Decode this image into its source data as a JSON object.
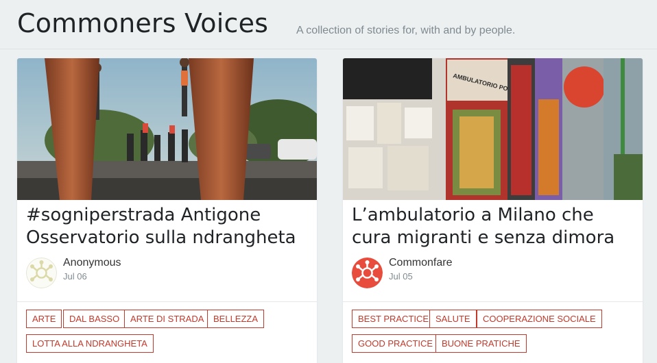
{
  "header": {
    "title": "Commoners Voices",
    "tagline": "A collection of stories for, with and by people."
  },
  "cards": [
    {
      "title": "#sogniperstrada Antigone Osservatorio sulla ndrangheta",
      "author": "Anonymous",
      "date": "Jul 06",
      "tags": [
        "ARTE",
        "DAL BASSO",
        "ARTE DI STRADA",
        "BELLEZZA",
        "LOTTA ALLA NDRANGHETA"
      ]
    },
    {
      "title": "L’ambulatorio a Milano che cura migranti e senza dimora",
      "author": "Commonfare",
      "date": "Jul 05",
      "tags": [
        "BEST PRACTICE",
        "SALUTE",
        "COOPERAZIONE SOCIALE",
        "GOOD PRACTICE",
        "BUONE PRATICHE"
      ],
      "image_sign_text": "AMBULATORIO POPOLARE"
    }
  ],
  "colors": {
    "background": "#ecf0f1",
    "tag_accent": "#c0392b",
    "avatar_orange": "#e74c3c"
  }
}
